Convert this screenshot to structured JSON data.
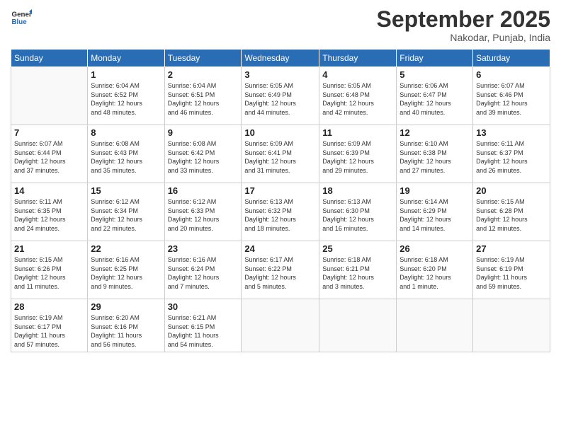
{
  "logo": {
    "general": "General",
    "blue": "Blue"
  },
  "header": {
    "month": "September 2025",
    "location": "Nakodar, Punjab, India"
  },
  "days_of_week": [
    "Sunday",
    "Monday",
    "Tuesday",
    "Wednesday",
    "Thursday",
    "Friday",
    "Saturday"
  ],
  "weeks": [
    [
      {
        "day": "",
        "info": ""
      },
      {
        "day": "1",
        "info": "Sunrise: 6:04 AM\nSunset: 6:52 PM\nDaylight: 12 hours\nand 48 minutes."
      },
      {
        "day": "2",
        "info": "Sunrise: 6:04 AM\nSunset: 6:51 PM\nDaylight: 12 hours\nand 46 minutes."
      },
      {
        "day": "3",
        "info": "Sunrise: 6:05 AM\nSunset: 6:49 PM\nDaylight: 12 hours\nand 44 minutes."
      },
      {
        "day": "4",
        "info": "Sunrise: 6:05 AM\nSunset: 6:48 PM\nDaylight: 12 hours\nand 42 minutes."
      },
      {
        "day": "5",
        "info": "Sunrise: 6:06 AM\nSunset: 6:47 PM\nDaylight: 12 hours\nand 40 minutes."
      },
      {
        "day": "6",
        "info": "Sunrise: 6:07 AM\nSunset: 6:46 PM\nDaylight: 12 hours\nand 39 minutes."
      }
    ],
    [
      {
        "day": "7",
        "info": "Sunrise: 6:07 AM\nSunset: 6:44 PM\nDaylight: 12 hours\nand 37 minutes."
      },
      {
        "day": "8",
        "info": "Sunrise: 6:08 AM\nSunset: 6:43 PM\nDaylight: 12 hours\nand 35 minutes."
      },
      {
        "day": "9",
        "info": "Sunrise: 6:08 AM\nSunset: 6:42 PM\nDaylight: 12 hours\nand 33 minutes."
      },
      {
        "day": "10",
        "info": "Sunrise: 6:09 AM\nSunset: 6:41 PM\nDaylight: 12 hours\nand 31 minutes."
      },
      {
        "day": "11",
        "info": "Sunrise: 6:09 AM\nSunset: 6:39 PM\nDaylight: 12 hours\nand 29 minutes."
      },
      {
        "day": "12",
        "info": "Sunrise: 6:10 AM\nSunset: 6:38 PM\nDaylight: 12 hours\nand 27 minutes."
      },
      {
        "day": "13",
        "info": "Sunrise: 6:11 AM\nSunset: 6:37 PM\nDaylight: 12 hours\nand 26 minutes."
      }
    ],
    [
      {
        "day": "14",
        "info": "Sunrise: 6:11 AM\nSunset: 6:35 PM\nDaylight: 12 hours\nand 24 minutes."
      },
      {
        "day": "15",
        "info": "Sunrise: 6:12 AM\nSunset: 6:34 PM\nDaylight: 12 hours\nand 22 minutes."
      },
      {
        "day": "16",
        "info": "Sunrise: 6:12 AM\nSunset: 6:33 PM\nDaylight: 12 hours\nand 20 minutes."
      },
      {
        "day": "17",
        "info": "Sunrise: 6:13 AM\nSunset: 6:32 PM\nDaylight: 12 hours\nand 18 minutes."
      },
      {
        "day": "18",
        "info": "Sunrise: 6:13 AM\nSunset: 6:30 PM\nDaylight: 12 hours\nand 16 minutes."
      },
      {
        "day": "19",
        "info": "Sunrise: 6:14 AM\nSunset: 6:29 PM\nDaylight: 12 hours\nand 14 minutes."
      },
      {
        "day": "20",
        "info": "Sunrise: 6:15 AM\nSunset: 6:28 PM\nDaylight: 12 hours\nand 12 minutes."
      }
    ],
    [
      {
        "day": "21",
        "info": "Sunrise: 6:15 AM\nSunset: 6:26 PM\nDaylight: 12 hours\nand 11 minutes."
      },
      {
        "day": "22",
        "info": "Sunrise: 6:16 AM\nSunset: 6:25 PM\nDaylight: 12 hours\nand 9 minutes."
      },
      {
        "day": "23",
        "info": "Sunrise: 6:16 AM\nSunset: 6:24 PM\nDaylight: 12 hours\nand 7 minutes."
      },
      {
        "day": "24",
        "info": "Sunrise: 6:17 AM\nSunset: 6:22 PM\nDaylight: 12 hours\nand 5 minutes."
      },
      {
        "day": "25",
        "info": "Sunrise: 6:18 AM\nSunset: 6:21 PM\nDaylight: 12 hours\nand 3 minutes."
      },
      {
        "day": "26",
        "info": "Sunrise: 6:18 AM\nSunset: 6:20 PM\nDaylight: 12 hours\nand 1 minute."
      },
      {
        "day": "27",
        "info": "Sunrise: 6:19 AM\nSunset: 6:19 PM\nDaylight: 11 hours\nand 59 minutes."
      }
    ],
    [
      {
        "day": "28",
        "info": "Sunrise: 6:19 AM\nSunset: 6:17 PM\nDaylight: 11 hours\nand 57 minutes."
      },
      {
        "day": "29",
        "info": "Sunrise: 6:20 AM\nSunset: 6:16 PM\nDaylight: 11 hours\nand 56 minutes."
      },
      {
        "day": "30",
        "info": "Sunrise: 6:21 AM\nSunset: 6:15 PM\nDaylight: 11 hours\nand 54 minutes."
      },
      {
        "day": "",
        "info": ""
      },
      {
        "day": "",
        "info": ""
      },
      {
        "day": "",
        "info": ""
      },
      {
        "day": "",
        "info": ""
      }
    ]
  ]
}
